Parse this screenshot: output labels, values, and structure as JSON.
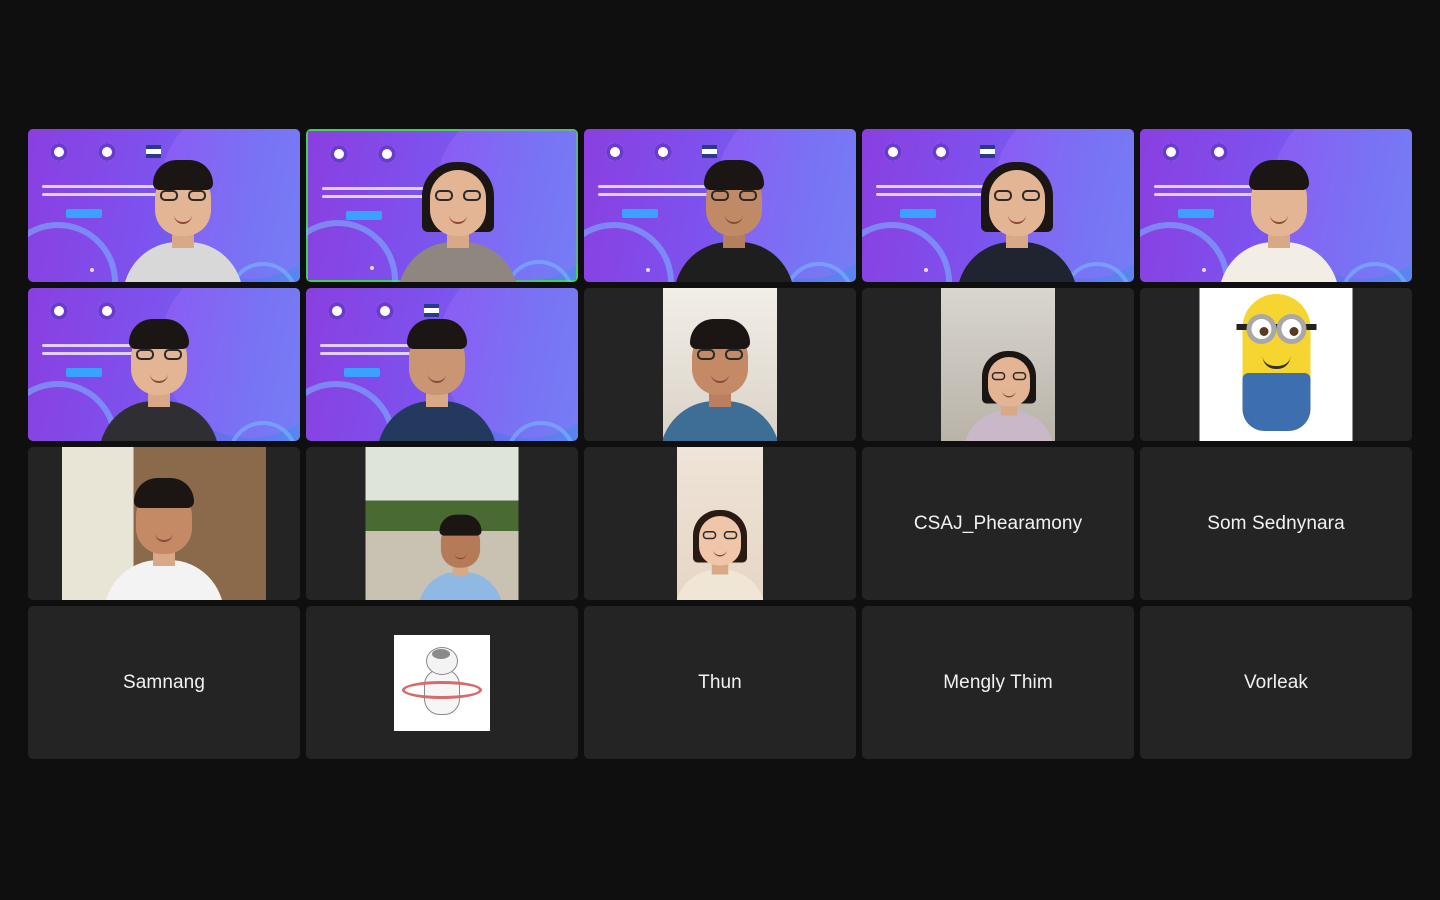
{
  "meeting": {
    "layout": "gallery",
    "grid": {
      "columns": 5,
      "rows": 4
    },
    "active_speaker_color": "#43d15a"
  },
  "participants": [
    {
      "id": 1,
      "name": "",
      "video": "on",
      "background": "purple-webinar",
      "speaking": false
    },
    {
      "id": 2,
      "name": "",
      "video": "on",
      "background": "purple-webinar",
      "speaking": true
    },
    {
      "id": 3,
      "name": "",
      "video": "on",
      "background": "purple-webinar",
      "speaking": false
    },
    {
      "id": 4,
      "name": "",
      "video": "on",
      "background": "purple-webinar",
      "speaking": false
    },
    {
      "id": 5,
      "name": "",
      "video": "on",
      "background": "purple-webinar",
      "speaking": false
    },
    {
      "id": 6,
      "name": "",
      "video": "on",
      "background": "purple-webinar",
      "speaking": false
    },
    {
      "id": 7,
      "name": "",
      "video": "on",
      "background": "purple-webinar",
      "speaking": false
    },
    {
      "id": 8,
      "name": "",
      "video": "on",
      "background": "camera",
      "speaking": false
    },
    {
      "id": 9,
      "name": "",
      "video": "on",
      "background": "camera",
      "speaking": false
    },
    {
      "id": 10,
      "name": "",
      "video": "profile-picture",
      "icon": "minion-avatar",
      "speaking": false
    },
    {
      "id": 11,
      "name": "",
      "video": "on",
      "background": "camera",
      "speaking": false
    },
    {
      "id": 12,
      "name": "",
      "video": "on",
      "background": "camera",
      "speaking": false
    },
    {
      "id": 13,
      "name": "",
      "video": "on",
      "background": "camera",
      "speaking": false
    },
    {
      "id": 14,
      "name": "CSAJ_Phearamony",
      "video": "off"
    },
    {
      "id": 15,
      "name": "Som Sednynara",
      "video": "off"
    },
    {
      "id": 16,
      "name": "Samnang",
      "video": "off"
    },
    {
      "id": 17,
      "name": "",
      "video": "profile-picture",
      "icon": "cat-hula-hoop-avatar",
      "speaking": false
    },
    {
      "id": 18,
      "name": "Thun",
      "video": "off"
    },
    {
      "id": 19,
      "name": "Mengly Thim",
      "video": "off"
    },
    {
      "id": 20,
      "name": "Vorleak",
      "video": "off"
    }
  ]
}
